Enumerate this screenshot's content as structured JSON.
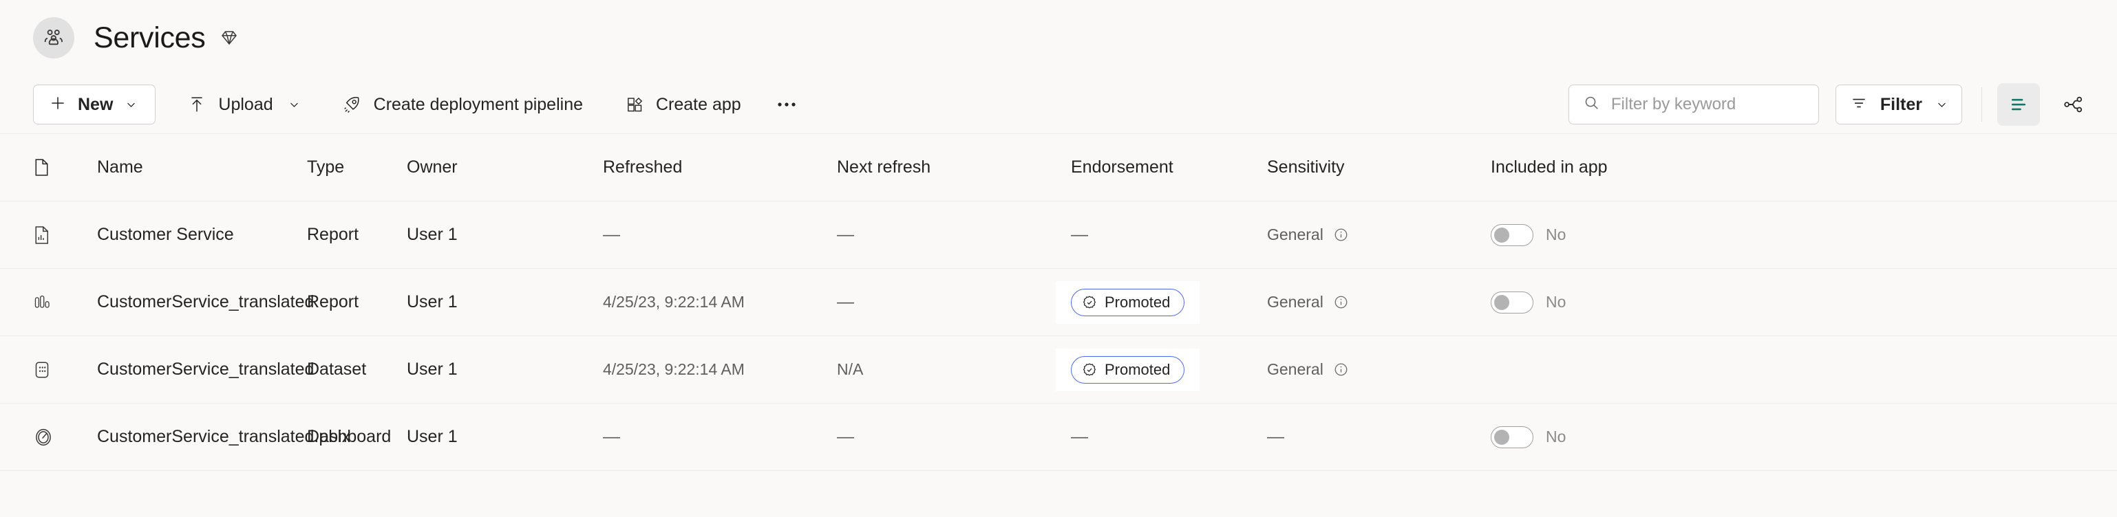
{
  "header": {
    "workspace_title": "Services",
    "avatar_icon": "people-group-icon",
    "premium_icon": "diamond-icon"
  },
  "toolbar": {
    "new_button": {
      "label": "New",
      "icon": "plus-icon",
      "chevron": "chevron-down-icon"
    },
    "upload_button": {
      "label": "Upload",
      "icon": "upload-arrow-icon",
      "chevron": "chevron-down-icon"
    },
    "create_pipeline_button": {
      "label": "Create deployment pipeline",
      "icon": "rocket-icon"
    },
    "create_app_button": {
      "label": "Create app",
      "icon": "app-grid-icon"
    },
    "overflow_button": {
      "label": "•••",
      "icon": "more-horizontal-icon"
    },
    "search": {
      "placeholder": "Filter by keyword",
      "value": "",
      "icon": "search-icon"
    },
    "filter_button": {
      "label": "Filter",
      "icon": "filter-lines-icon",
      "chevron": "chevron-down-icon"
    },
    "list_view_button": {
      "icon": "list-view-icon",
      "selected": true,
      "accent_color": "#117865"
    },
    "lineage_view_button": {
      "icon": "lineage-icon",
      "selected": false
    }
  },
  "table": {
    "columns": [
      {
        "key": "icon",
        "label": "",
        "icon": "file-column-icon"
      },
      {
        "key": "name",
        "label": "Name"
      },
      {
        "key": "type",
        "label": "Type"
      },
      {
        "key": "owner",
        "label": "Owner"
      },
      {
        "key": "refreshed",
        "label": "Refreshed"
      },
      {
        "key": "next_refresh",
        "label": "Next refresh"
      },
      {
        "key": "endorsement",
        "label": "Endorsement"
      },
      {
        "key": "sensitivity",
        "label": "Sensitivity"
      },
      {
        "key": "included_in_app",
        "label": "Included in app"
      }
    ],
    "rows": [
      {
        "icon": "report-page-icon",
        "name": "Customer Service",
        "type": "Report",
        "owner": "User 1",
        "refreshed": "—",
        "next_refresh": "—",
        "endorsement": "—",
        "sensitivity": "General",
        "sensitivity_info_icon": "info-icon",
        "included_in_app": "No",
        "toggle_on": false,
        "has_toggle": true,
        "has_badge": false
      },
      {
        "icon": "bar-chart-report-icon",
        "name": "CustomerService_translated",
        "type": "Report",
        "owner": "User 1",
        "refreshed": "4/25/23, 9:22:14 AM",
        "next_refresh": "—",
        "endorsement": "Promoted",
        "sensitivity": "General",
        "sensitivity_info_icon": "info-icon",
        "included_in_app": "No",
        "toggle_on": false,
        "has_toggle": true,
        "has_badge": true
      },
      {
        "icon": "dataset-icon",
        "name": "CustomerService_translated",
        "type": "Dataset",
        "owner": "User 1",
        "refreshed": "4/25/23, 9:22:14 AM",
        "next_refresh": "N/A",
        "endorsement": "Promoted",
        "sensitivity": "General",
        "sensitivity_info_icon": "info-icon",
        "included_in_app": "",
        "toggle_on": false,
        "has_toggle": false,
        "has_badge": true
      },
      {
        "icon": "dashboard-gauge-icon",
        "name": "CustomerService_translated.pbix",
        "type": "Dashboard",
        "owner": "User 1",
        "refreshed": "—",
        "next_refresh": "—",
        "endorsement": "—",
        "sensitivity": "—",
        "sensitivity_info_icon": "",
        "included_in_app": "No",
        "toggle_on": false,
        "has_toggle": true,
        "has_badge": false
      }
    ]
  }
}
